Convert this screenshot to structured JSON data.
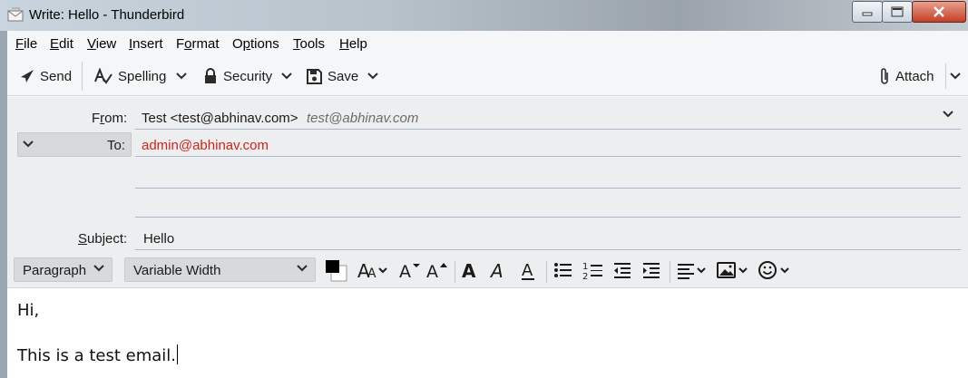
{
  "window": {
    "title": "Write: Hello - Thunderbird"
  },
  "menu": [
    {
      "pre": "",
      "u": "F",
      "post": "ile"
    },
    {
      "pre": "",
      "u": "E",
      "post": "dit"
    },
    {
      "pre": "",
      "u": "V",
      "post": "iew"
    },
    {
      "pre": "",
      "u": "I",
      "post": "nsert"
    },
    {
      "pre": "F",
      "u": "o",
      "post": "rmat"
    },
    {
      "pre": "O",
      "u": "p",
      "post": "tions"
    },
    {
      "pre": "",
      "u": "T",
      "post": "ools"
    },
    {
      "pre": "",
      "u": "H",
      "post": "elp"
    }
  ],
  "toolbar": {
    "send_label": "Send",
    "spelling_label": "Spelling",
    "security_label": "Security",
    "save_label": "Save",
    "attach_label": "Attach"
  },
  "headers": {
    "from_label_pre": "F",
    "from_label_u": "r",
    "from_label_post": "om:",
    "from_name": "Test <test@abhinav.com>",
    "from_email": "test@abhinav.com",
    "to_label": "To:",
    "to_value": "admin@abhinav.com",
    "subject_label_u": "S",
    "subject_label_post": "ubject:",
    "subject_value": "Hello"
  },
  "format": {
    "paragraph_value": "Paragraph",
    "font_value": "Variable Width",
    "text_color": "#000000",
    "bg_color": "#ffffff"
  },
  "body": {
    "line1": "Hi,",
    "line2": "This is a test email."
  },
  "colors": {
    "recipient": "#d0231a",
    "accent_line": "#a8b8c8"
  }
}
